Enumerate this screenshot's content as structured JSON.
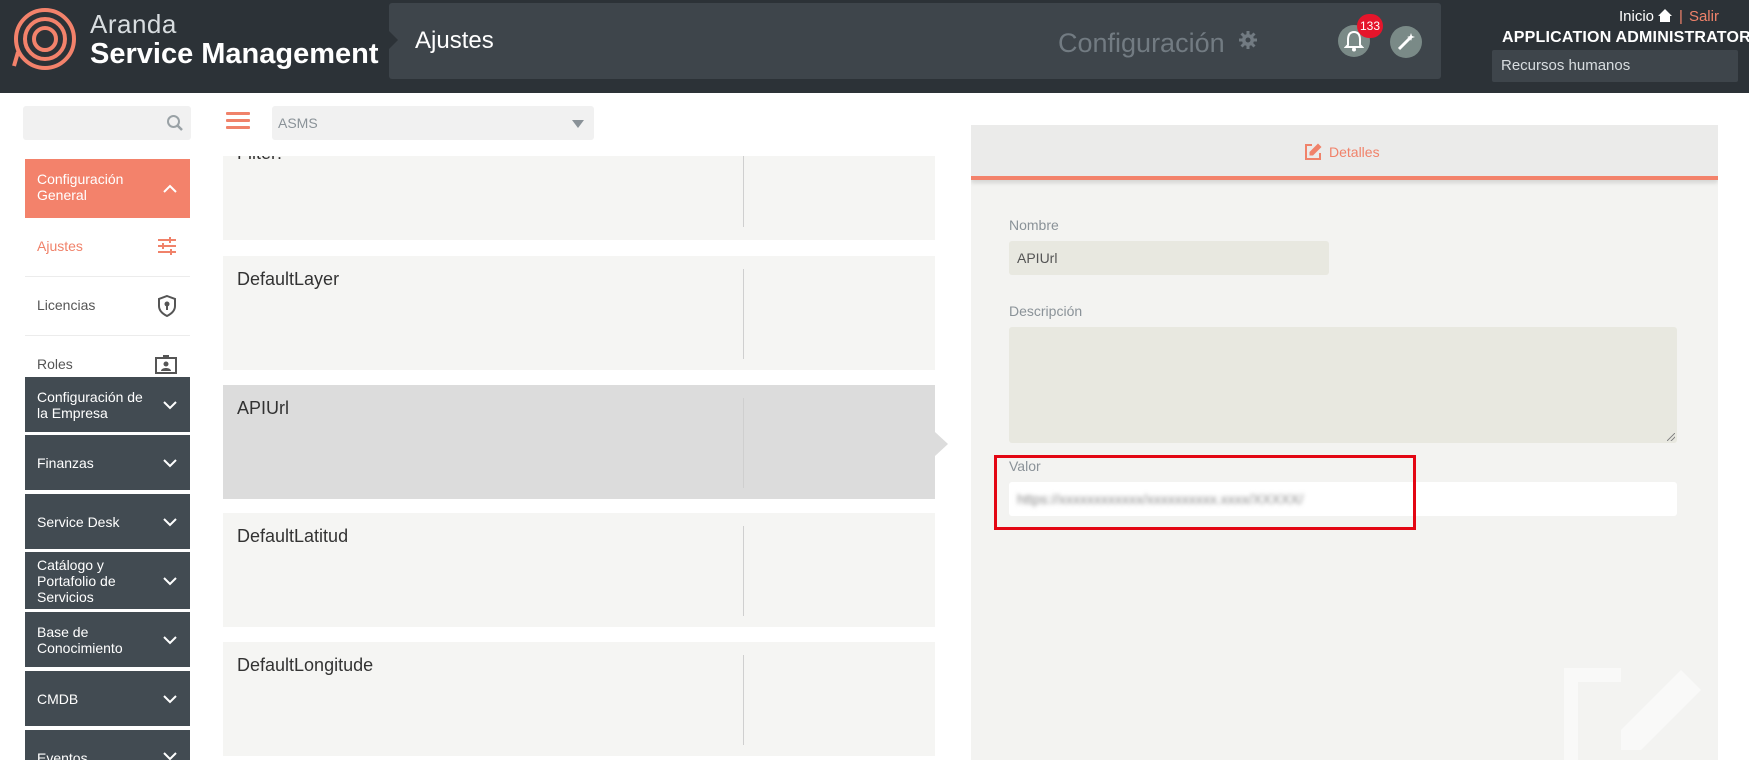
{
  "app": {
    "brand_line1": "Aranda",
    "brand_line2": "Service Management",
    "page_title": "Ajustes",
    "config_label": "Configuración",
    "notifications_count": "133",
    "home_link": "Inicio",
    "logout_link": "Salir",
    "user_name": "APPLICATION ADMINISTRATOR",
    "department": "Recursos humanos",
    "accent_color": "#f3826b",
    "dark_color": "#2c3237"
  },
  "toolbar": {
    "module": "ASMS"
  },
  "sidebar": {
    "active_group": "Configuración General",
    "sub_items": [
      {
        "label": "Ajustes",
        "icon": "sliders-icon",
        "active": true
      },
      {
        "label": "Licencias",
        "icon": "shield-key-icon",
        "active": false
      },
      {
        "label": "Roles",
        "icon": "id-badge-icon",
        "active": false
      }
    ],
    "groups": [
      "Configuración de la Empresa",
      "Finanzas",
      "Service Desk",
      "Catálogo y Portafolio de Servicios",
      "Base de Conocimiento",
      "CMDB",
      "Eventos"
    ]
  },
  "settings_list": [
    {
      "name": "Filter:"
    },
    {
      "name": "DefaultLayer"
    },
    {
      "name": "APIUrl",
      "selected": true
    },
    {
      "name": "DefaultLatitud"
    },
    {
      "name": "DefaultLongitude"
    }
  ],
  "detail": {
    "tab_label": "Detalles",
    "name_label": "Nombre",
    "name_value": "APIUrl",
    "description_label": "Descripción",
    "description_value": "",
    "value_label": "Valor",
    "value_value": "https://xxxxxxxxxxxx/xxxxxxxxxx.xxxx/XXXXX/"
  }
}
